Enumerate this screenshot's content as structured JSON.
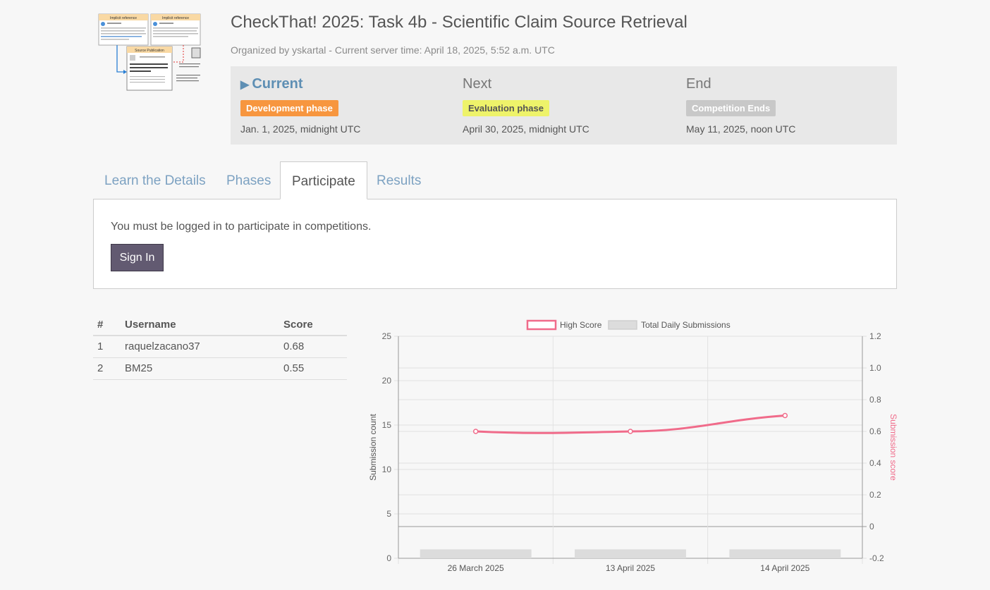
{
  "header": {
    "title": "CheckThat! 2025: Task 4b - Scientific Claim Source Retrieval",
    "subtitle": "Organized by yskartal - Current server time: April 18, 2025, 5:52 a.m. UTC"
  },
  "phases": {
    "current": {
      "heading": "Current",
      "badge": "Development phase",
      "date": "Jan. 1, 2025, midnight UTC",
      "badge_color": "#f7963f"
    },
    "next": {
      "heading": "Next",
      "badge": "Evaluation phase",
      "date": "April 30, 2025, midnight UTC",
      "badge_color": "#eef36a"
    },
    "end": {
      "heading": "End",
      "badge": "Competition Ends",
      "date": "May 11, 2025, noon UTC",
      "badge_color": "#c8c8c8"
    }
  },
  "tabs": [
    {
      "label": "Learn the Details"
    },
    {
      "label": "Phases"
    },
    {
      "label": "Participate",
      "active": true
    },
    {
      "label": "Results"
    }
  ],
  "participate": {
    "message": "You must be logged in to participate in competitions.",
    "sign_in_label": "Sign In"
  },
  "leaderboard": {
    "headers": [
      "#",
      "Username",
      "Score"
    ],
    "rows": [
      {
        "rank": "1",
        "username": "raquelzacano37",
        "score": "0.68"
      },
      {
        "rank": "2",
        "username": "BM25",
        "score": "0.55"
      }
    ]
  },
  "chart_data": {
    "type": "line",
    "categories": [
      "26 March 2025",
      "13 April 2025",
      "14 April 2025"
    ],
    "series": [
      {
        "name": "High Score",
        "type": "line",
        "axis": "right",
        "values": [
          0.6,
          0.6,
          0.7
        ],
        "color": "#f06b8a"
      },
      {
        "name": "Total Daily Submissions",
        "type": "bar",
        "axis": "left",
        "values": [
          1,
          1,
          1
        ],
        "color": "#dcdcdc"
      }
    ],
    "ylabel_left": "Submission count",
    "ylabel_right": "Submission score",
    "ylim_left": [
      0,
      25
    ],
    "yticks_left": [
      "0",
      "5",
      "10",
      "15",
      "20",
      "25"
    ],
    "ylim_right": [
      -0.2,
      1.2
    ],
    "yticks_right": [
      "-0.2",
      "0",
      "0.2",
      "0.4",
      "0.6",
      "0.8",
      "1.0",
      "1.2"
    ],
    "legend": "top",
    "grid": true
  },
  "logo": {
    "panel_1_title": "Implicit reference",
    "panel_2_title": "Implicit reference",
    "panel_3_title": "Source Publication"
  }
}
